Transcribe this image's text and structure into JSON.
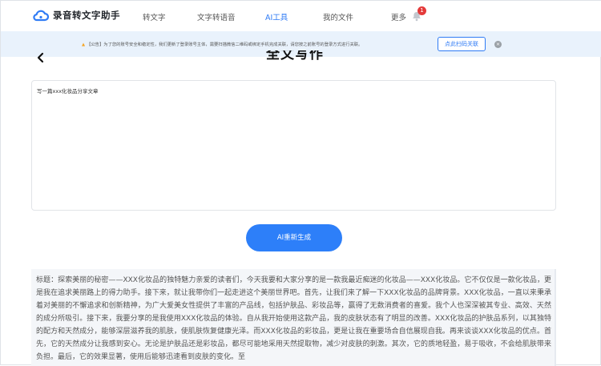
{
  "app": {
    "name": "录音转文字助手"
  },
  "nav": {
    "items": [
      {
        "label": "转文字",
        "active": false
      },
      {
        "label": "文字转语音",
        "active": false
      },
      {
        "label": "AI工具",
        "active": true
      },
      {
        "label": "我的文件",
        "active": false
      },
      {
        "label": "更多",
        "active": false
      }
    ],
    "notification_count": "1"
  },
  "notice": {
    "text": "【公告】为了您的账号安全和稳定性，我们更新了登录账号主体，需要扫描微信二维码或绑定手机完成关联，请您按之前账号的登录方式进行关联。",
    "button_label": "点此扫码关联",
    "close_glyph": "×"
  },
  "page": {
    "title": "全文写作",
    "back_glyph": "‹"
  },
  "prompt": {
    "text": "写一篇xxx化妆品分享文章"
  },
  "actions": {
    "regenerate_label": "AI重新生成"
  },
  "result": {
    "text": "标题：探索美丽的秘密——XXX化妆品的独特魅力亲爱的读者们，今天我要和大家分享的是一款我最近痴迷的化妆品——XXX化妆品。它不仅仅是一款化妆品，更是我在追求美丽路上的得力助手。接下来，就让我带你们一起走进这个美丽世界吧。首先，让我们来了解一下XXX化妆品的品牌背景。XXX化妆品，一直以来秉承着对美丽的不懈追求和创新精神，为广大爱美女性提供了丰富的产品线，包括护肤品、彩妆品等，赢得了无数消费者的喜爱。我个人也深深被其专业、高效、天然的成分所吸引。接下来，我要分享的是我使用XXX化妆品的体验。自从我开始使用这款产品，我的皮肤状态有了明显的改善。XXX化妆品的护肤品系列，以其独特的配方和天然成分，能够深层滋养我的肌肤，使肌肤恢复健康光泽。而XXX化妆品的彩妆品，更是让我在重要场合自信展现自我。再来谈谈XXX化妆品的优点。首先，它的天然成分让我感到安心。无论是护肤品还是彩妆品，都尽可能地采用天然提取物，减少对皮肤的刺激。其次，它的质地轻盈，易于吸收，不会给肌肤带来负担。最后，它的效果显著，使用后能够迅速看到皮肤的变化。至"
  },
  "colors": {
    "accent": "#2f7bf5",
    "notice_bg": "#e9f2fc",
    "badge": "#e43a3a",
    "result_bg": "#f4f6f9"
  },
  "icons": {
    "logo": "cloud-logo-icon",
    "bell": "bell-icon",
    "back": "chevron-left-icon",
    "close": "close-icon",
    "warning": "warning-icon"
  }
}
